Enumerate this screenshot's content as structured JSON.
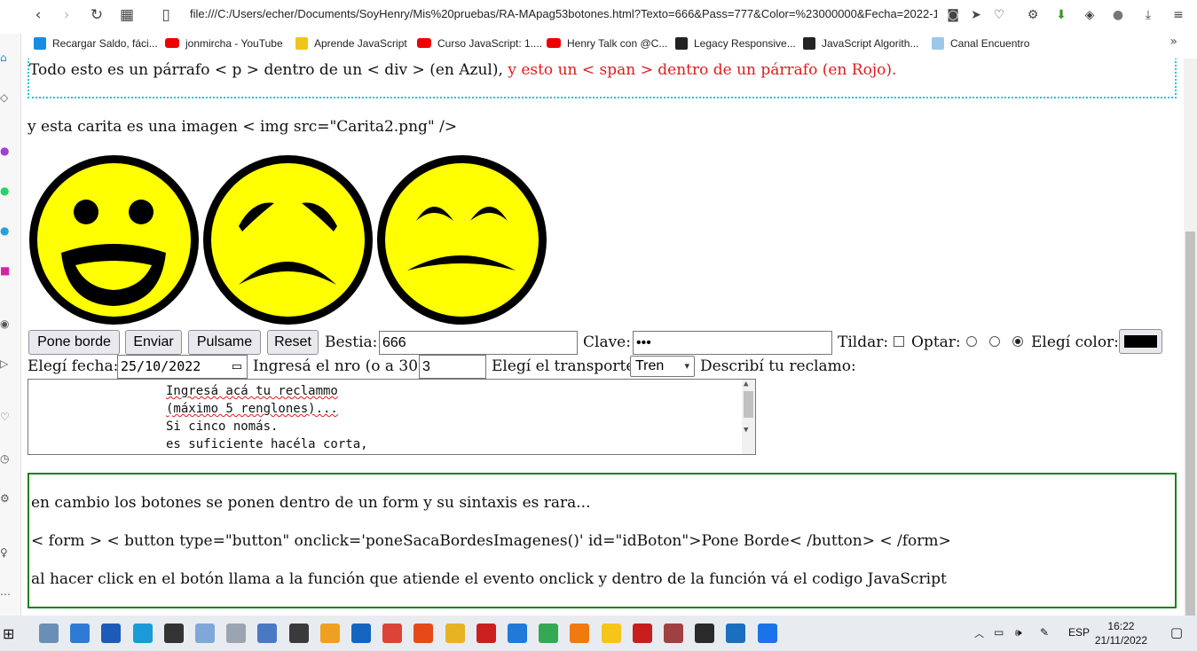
{
  "browser": {
    "url": "file:///C:/Users/echer/Documents/SoyHenry/Mis%20pruebas/RA-MApag53botones.html?Texto=666&Pass=777&Color=%23000000&Fecha=2022-1",
    "nav_icons": [
      "back-icon",
      "forward-icon",
      "reload-icon",
      "grid-icon",
      "page-icon"
    ],
    "toolbar_icons": [
      "camera-icon",
      "send-icon",
      "heart-icon",
      "settings-icon",
      "download-arrow-icon",
      "cube-icon",
      "profile-icon",
      "download-icon",
      "menu-icon"
    ]
  },
  "bookmarks": [
    {
      "label": "Recargar Saldo, fáci...",
      "icon": "recharge-icon"
    },
    {
      "label": "jonmircha - YouTube",
      "icon": "youtube-icon"
    },
    {
      "label": "Aprende JavaScript",
      "icon": "js-icon"
    },
    {
      "label": "Curso JavaScript: 1....",
      "icon": "youtube-icon"
    },
    {
      "label": "Henry Talk con @C...",
      "icon": "youtube-icon"
    },
    {
      "label": "Legacy Responsive...",
      "icon": "freecodecamp-icon"
    },
    {
      "label": "JavaScript Algorith...",
      "icon": "freecodecamp-icon"
    },
    {
      "label": "Canal Encuentro",
      "icon": "encuentro-icon"
    }
  ],
  "bookmarks_more": "»",
  "page": {
    "para1_blue": "Todo esto es un párrafo < p > dentro de un < div > (en Azul), ",
    "para1_red": "y esto un < span > dentro de un párrafo (en Rojo).",
    "para2": "y esta carita es una imagen < img src=\"Carita2.png\" />",
    "faces": [
      "happy-face",
      "sad-face",
      "tired-face"
    ],
    "form": {
      "btn_pone_borde": "Pone borde",
      "btn_enviar": "Enviar",
      "btn_pulsame": "Pulsame",
      "btn_reset": "Reset",
      "label_bestia": "Bestia:",
      "bestia_value": "666",
      "label_clave": "Clave:",
      "clave_value": "•••",
      "label_tildar": "Tildar:",
      "label_optar": "Optar:",
      "label_color": "Elegí color:",
      "color_value": "#000000",
      "label_fecha": "Elegí fecha:",
      "fecha_value": "25/10/2022",
      "label_nro": "Ingresá el nro (o a 30):",
      "nro_value": "3",
      "label_transporte": "Elegí el transporte:",
      "transporte_value": "Tren",
      "label_reclamo": "Describí tu reclamo:",
      "reclamo_lines": [
        "Ingresá acá tu reclammo",
        "(máximo 5 renglones)...",
        "Si cinco nomás.",
        "es suficiente hacéla corta,"
      ]
    },
    "green": {
      "line1": "en cambio los botones se ponen dentro de un form y su sintaxis es rara...",
      "line2": "< form > < button type=\"button\" onclick='poneSacaBordesImagenes()' id=\"idBoton\">Pone Borde< /button> < /form>",
      "line3": "al hacer click en el botón llama a la función que atiende el evento onclick y dentro de la función vá el codigo JavaScript"
    }
  },
  "taskbar": {
    "lang": "ESP",
    "time": "16:22",
    "date": "21/11/2022",
    "app_colors": [
      "#6a8fb5",
      "#2e7bd6",
      "#1e5bb8",
      "#1a9bd7",
      "#333333",
      "#7fa7d8",
      "#9aa5b1",
      "#4a79c4",
      "#3a3a3a",
      "#f0a020",
      "#1565c0",
      "#db4437",
      "#e64a19",
      "#e6b422",
      "#cc1f1f",
      "#1f7ad9",
      "#34a853",
      "#f07a10",
      "#f5c518",
      "#c81e1e",
      "#a04040",
      "#2a2a2a",
      "#1a6fc0",
      "#1a73e8"
    ]
  },
  "colors": {
    "cyan_border": "#22c5d8",
    "red_text": "#e01b1b",
    "green_border": "#188218",
    "face_yellow": "#ffff00"
  }
}
